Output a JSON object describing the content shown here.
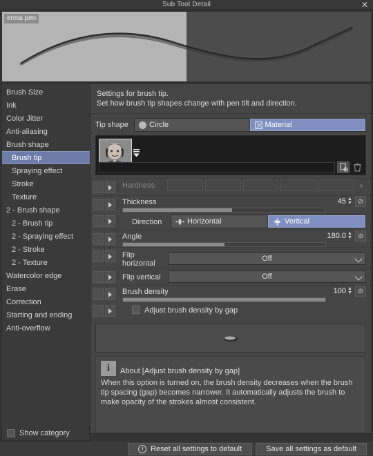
{
  "window": {
    "title": "Sub Tool Detail",
    "close_label": "✕"
  },
  "preview": {
    "brush_name": "erma pen"
  },
  "sidebar": {
    "items": [
      {
        "label": "Brush Size",
        "indent": false,
        "selected": false
      },
      {
        "label": "Ink",
        "indent": false,
        "selected": false
      },
      {
        "label": "Color Jitter",
        "indent": false,
        "selected": false
      },
      {
        "label": "Anti-aliasing",
        "indent": false,
        "selected": false
      },
      {
        "label": "Brush shape",
        "indent": false,
        "selected": false
      },
      {
        "label": "Brush tip",
        "indent": true,
        "selected": true
      },
      {
        "label": "Spraying effect",
        "indent": true,
        "selected": false
      },
      {
        "label": "Stroke",
        "indent": true,
        "selected": false
      },
      {
        "label": "Texture",
        "indent": true,
        "selected": false
      },
      {
        "label": "2 - Brush shape",
        "indent": false,
        "selected": false
      },
      {
        "label": "2 - Brush tip",
        "indent": true,
        "selected": false
      },
      {
        "label": "2 - Spraying effect",
        "indent": true,
        "selected": false
      },
      {
        "label": "2 - Stroke",
        "indent": true,
        "selected": false
      },
      {
        "label": "2 - Texture",
        "indent": true,
        "selected": false
      },
      {
        "label": "Watercolor edge",
        "indent": false,
        "selected": false
      },
      {
        "label": "Erase",
        "indent": false,
        "selected": false
      },
      {
        "label": "Correction",
        "indent": false,
        "selected": false
      },
      {
        "label": "Starting and ending",
        "indent": false,
        "selected": false
      },
      {
        "label": "Anti-overflow",
        "indent": false,
        "selected": false
      }
    ],
    "show_category_label": "Show category"
  },
  "panel": {
    "description_line1": "Settings for brush tip.",
    "description_line2": "Set how brush tip shapes change with pen tilt and direction.",
    "tip_shape": {
      "label": "Tip shape",
      "options": [
        "Circle",
        "Material"
      ],
      "circle_label": "Circle",
      "material_label": "Material",
      "selected": "Material"
    },
    "rows": {
      "hardness": {
        "label": "Hardness",
        "enabled": false,
        "more_chevron": "›"
      },
      "thickness": {
        "label": "Thickness",
        "value": "45",
        "fill_percent": 54
      },
      "direction": {
        "label": "Direction",
        "options": [
          "Horizontal",
          "Vertical"
        ],
        "horizontal_label": "Horizontal",
        "vertical_label": "Vertical",
        "selected": "Vertical"
      },
      "angle": {
        "label": "Angle",
        "value": "180.0",
        "fill_percent": 50
      },
      "flip_horizontal": {
        "label": "Flip horizontal",
        "value": "Off"
      },
      "flip_vertical": {
        "label": "Flip vertical",
        "value": "Off"
      },
      "brush_density": {
        "label": "Brush density",
        "value": "100",
        "fill_percent": 100
      },
      "adjust_by_gap": {
        "label": "Adjust brush density by gap",
        "checked": false
      }
    },
    "about": {
      "title": "About [Adjust brush density by gap]",
      "text": "When this option is turned on, the brush density decreases when the brush tip spacing (gap) becomes narrower. It automatically adjusts the brush to make opacity of the strokes almost consistent."
    }
  },
  "footer": {
    "reset_label": "Reset all settings to default",
    "save_label": "Save all settings as default"
  },
  "colors": {
    "accent_blue": "#7f8fc0",
    "sidebar_selected": "#6d7ca8",
    "panel_bg": "#454545",
    "window_bg": "#333333"
  }
}
